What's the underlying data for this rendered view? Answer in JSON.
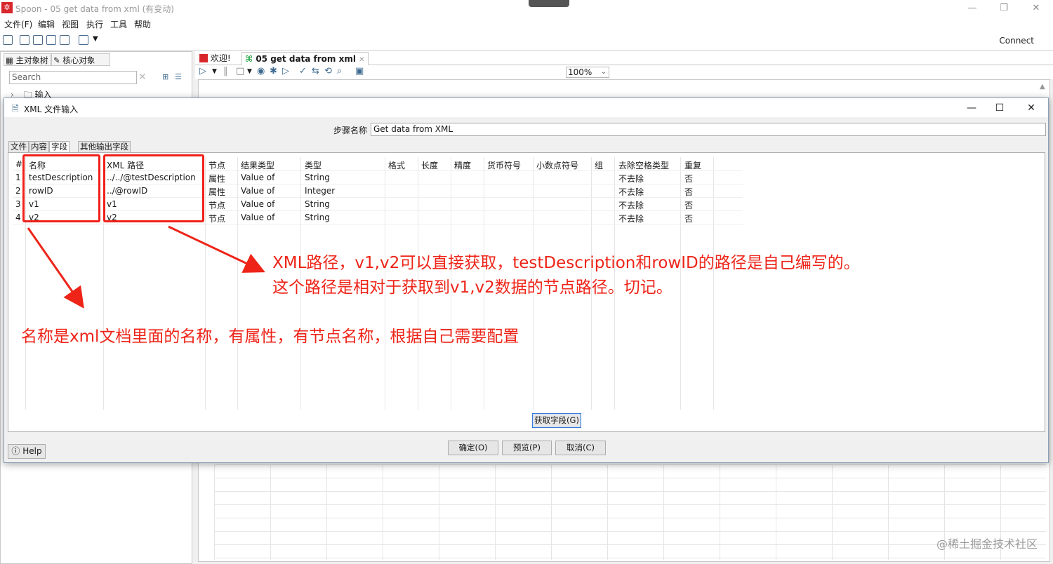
{
  "window": {
    "title": "Spoon - 05 get data from xml (有变动)",
    "app_icon": "✲",
    "minimize": "—",
    "maximize": "❐",
    "close": "✕"
  },
  "menu": [
    "文件(F)",
    "编辑",
    "视图",
    "执行",
    "工具",
    "帮助"
  ],
  "toolbar": {
    "connect": "Connect"
  },
  "left_panel": {
    "tabs": [
      "主对象树",
      "核心对象"
    ],
    "search_placeholder": "Search",
    "tree_items": [
      "输入"
    ]
  },
  "editor": {
    "tabs": [
      "欢迎!",
      "05 get data from xml"
    ],
    "zoom": "100%"
  },
  "dialog": {
    "title": "XML 文件输入",
    "step_name_label": "步骤名称",
    "step_name_value": "Get data from XML",
    "tabs": [
      "文件",
      "内容",
      "字段",
      "其他输出字段"
    ],
    "columns": [
      "#",
      "名称",
      "XML 路径",
      "节点",
      "结果类型",
      "类型",
      "格式",
      "长度",
      "精度",
      "货币符号",
      "小数点符号",
      "组",
      "去除空格类型",
      "重复"
    ],
    "rows": [
      [
        "1",
        "testDescription",
        "../../@testDescription",
        "属性",
        "Value of",
        "String",
        "",
        "",
        "",
        "",
        "",
        "",
        "不去除",
        "否"
      ],
      [
        "2",
        "rowID",
        "../@rowID",
        "属性",
        "Value of",
        "Integer",
        "",
        "",
        "",
        "",
        "",
        "",
        "不去除",
        "否"
      ],
      [
        "3",
        "v1",
        "v1",
        "节点",
        "Value of",
        "String",
        "",
        "",
        "",
        "",
        "",
        "",
        "不去除",
        "否"
      ],
      [
        "4",
        "v2",
        "v2",
        "节点",
        "Value of",
        "String",
        "",
        "",
        "",
        "",
        "",
        "",
        "不去除",
        "否"
      ]
    ],
    "get_fields_button": "获取字段(G)",
    "ok_button": "确定(O)",
    "preview_button": "预览(P)",
    "cancel_button": "取消(C)",
    "help_button": "Help"
  },
  "annotations": {
    "line1": "XML路径，v1,v2可以直接获取，testDescription和rowID的路径是自己编写的。",
    "line2": "这个路径是相对于获取到v1,v2数据的节点路径。切记。",
    "line3": "名称是xml文档里面的名称，有属性，有节点名称，根据自己需要配置",
    "color": "#ee2418"
  },
  "watermark": "@稀土掘金技术社区"
}
